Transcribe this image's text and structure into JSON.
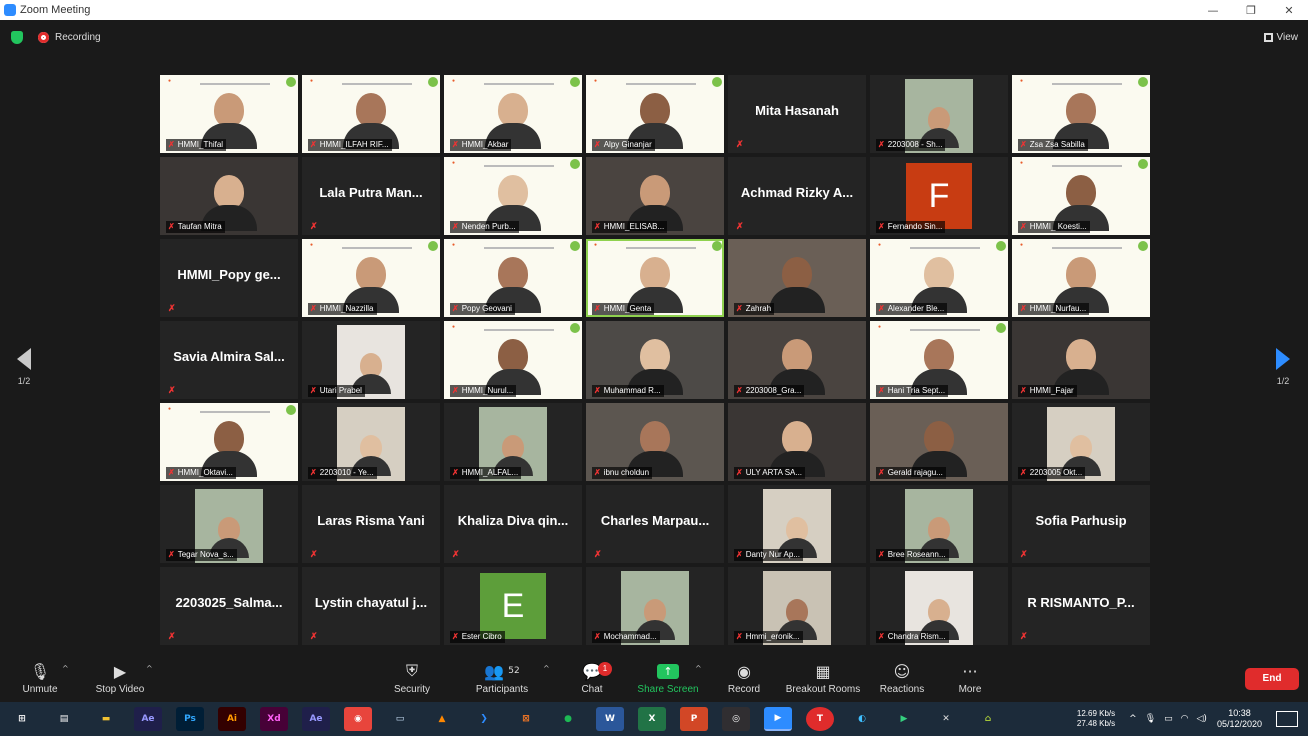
{
  "window": {
    "title": "Zoom Meeting"
  },
  "status": {
    "recording_label": "Recording",
    "view_label": "View"
  },
  "pager": {
    "left_label": "1/2",
    "right_label": "1/2"
  },
  "tiles": [
    [
      "HMMI_Thifal",
      "video"
    ],
    [
      "HMMI_ILFAH RIF...",
      "video"
    ],
    [
      "HMMI_Akbar",
      "video"
    ],
    [
      "Alpy Ginanjar",
      "video"
    ],
    [
      "Mita Hasanah",
      "name"
    ],
    [
      "2203008 - Sh...",
      "video"
    ],
    [
      "Zsa Zsa Sabilla",
      "video"
    ],
    [
      "Taufan Mitra",
      "video"
    ],
    [
      "Lala Putra Man...",
      "name"
    ],
    [
      "Nenden Purb...",
      "video"
    ],
    [
      "HMMI_ELISAB...",
      "video"
    ],
    [
      "Achmad Rizky A...",
      "name"
    ],
    [
      "Fernando Sin...",
      "avatar"
    ],
    [
      "HMMI_ Koesti...",
      "video"
    ],
    [
      "HMMI_Popy ge...",
      "name"
    ],
    [
      "HMMI_Nazzilla",
      "video"
    ],
    [
      "Popy Geovani",
      "video"
    ],
    [
      "HMMI_Genta",
      "video"
    ],
    [
      "Zahrah",
      "video"
    ],
    [
      "Alexander Ble...",
      "video"
    ],
    [
      "HMMI_Nurfau...",
      "video"
    ],
    [
      "Savia Almira Sal...",
      "name"
    ],
    [
      "Utari Prabel",
      "video"
    ],
    [
      "HMMI_Nurul...",
      "video"
    ],
    [
      "Muhammad R...",
      "video"
    ],
    [
      "2203008_Gra...",
      "video"
    ],
    [
      "Hani Tria Sept...",
      "video"
    ],
    [
      "HMMI_Fajar",
      "video"
    ],
    [
      "HMMI_Oktavi...",
      "video"
    ],
    [
      "2203010 - Ye...",
      "video"
    ],
    [
      "HMMI_ALFAL...",
      "video"
    ],
    [
      "ibnu choldun",
      "video"
    ],
    [
      "ULY ARTA SA...",
      "video"
    ],
    [
      "Gerald rajagu...",
      "video"
    ],
    [
      "2203005 Okt...",
      "video"
    ],
    [
      "Tegar Nova_s...",
      "video"
    ],
    [
      "Laras Risma Yani",
      "name"
    ],
    [
      "Khaliza Diva qin...",
      "name"
    ],
    [
      "Charles Marpau...",
      "name"
    ],
    [
      "Danty Nur Ap...",
      "video"
    ],
    [
      "Bree Roseann...",
      "video"
    ],
    [
      "Sofia Parhusip",
      "name"
    ],
    [
      "2203025_Salma...",
      "name"
    ],
    [
      "Lystin chayatul j...",
      "name"
    ],
    [
      "Ester Cibro",
      "avatar"
    ],
    [
      "Mochammad...",
      "video"
    ],
    [
      "Hmmi_eronik...",
      "video"
    ],
    [
      "Chandra Rism...",
      "video"
    ],
    [
      "R RISMANTO_P...",
      "name"
    ]
  ],
  "avatars": {
    "Fernando Sin...": {
      "letter": "F",
      "color": "#c83c12"
    },
    "Ester Cibro": {
      "letter": "E",
      "color": "#5d9e3a"
    }
  },
  "toolbar": {
    "unmute": "Unmute",
    "stop_video": "Stop Video",
    "security": "Security",
    "participants": "Participants",
    "participants_count": "52",
    "chat": "Chat",
    "chat_badge": "1",
    "share_screen": "Share Screen",
    "record": "Record",
    "breakout": "Breakout Rooms",
    "reactions": "Reactions",
    "more": "More",
    "end": "End"
  },
  "taskbar": {
    "apps": [
      "windows-start",
      "task-view",
      "file-explorer",
      "Ae",
      "Ps",
      "Ai",
      "Xd",
      "Ae",
      "chrome",
      "notes",
      "vlc",
      "vscode",
      "xampp",
      "spotify",
      "W",
      "X",
      "P",
      "obs",
      "zoom",
      "T",
      "edge",
      "arrow",
      "tools",
      "android"
    ],
    "speed_up": "12.69 Kb/s",
    "speed_down": "27.48 Kb/s",
    "time": "10:38",
    "date": "05/12/2020"
  },
  "colors": {
    "accent": "#2d8cff",
    "end_red": "#e02c2c",
    "share_green": "#22c55e",
    "active_speaker": "#8fd14f"
  }
}
